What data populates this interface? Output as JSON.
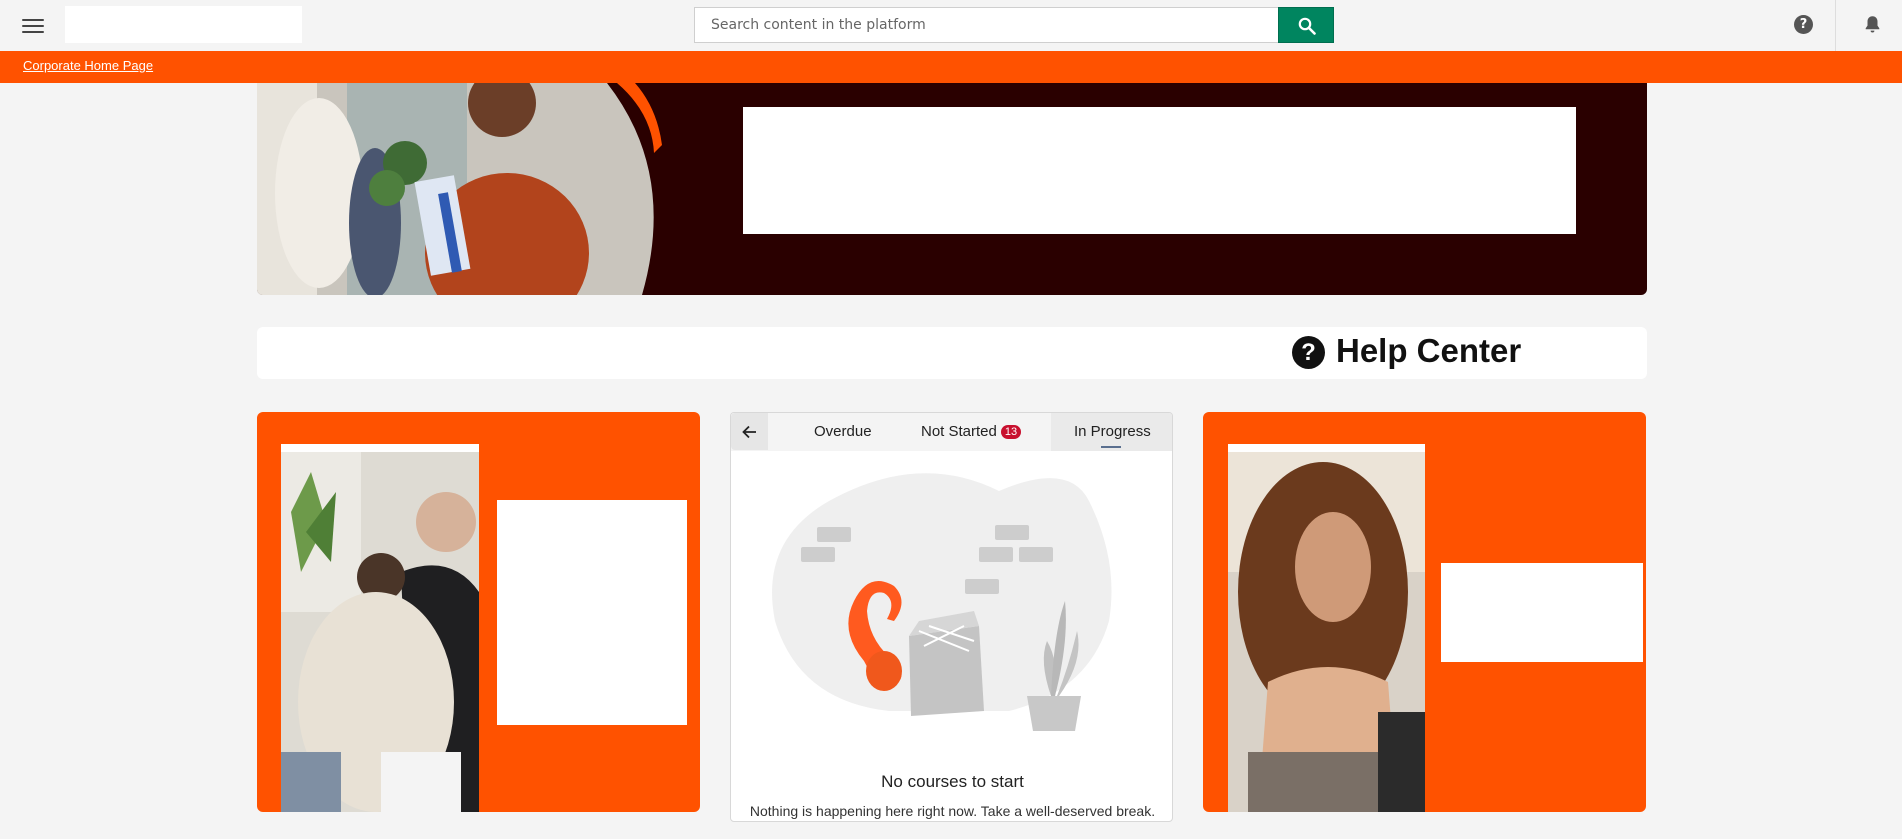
{
  "header": {
    "search_placeholder": "Search content in the platform",
    "help_icon": "question-circle-icon",
    "notifications_icon": "bell-icon",
    "menu_icon": "hamburger-menu-icon"
  },
  "linkbar": {
    "link_label": "Corporate Home Page"
  },
  "help_center": {
    "title": "Help Center",
    "icon_glyph": "?"
  },
  "courses": {
    "tabs": [
      {
        "label": "Overdue"
      },
      {
        "label": "Not Started",
        "badge": "13"
      },
      {
        "label": "In Progress"
      }
    ],
    "active_tab": "In Progress",
    "empty_title": "No courses to start",
    "empty_message": "Nothing is happening here right now. Take a well-deserved break."
  },
  "colors": {
    "brand_orange": "#ff5200",
    "search_green": "#00855f",
    "hero_dark": "#2a0000",
    "badge_red": "#c8102e"
  }
}
